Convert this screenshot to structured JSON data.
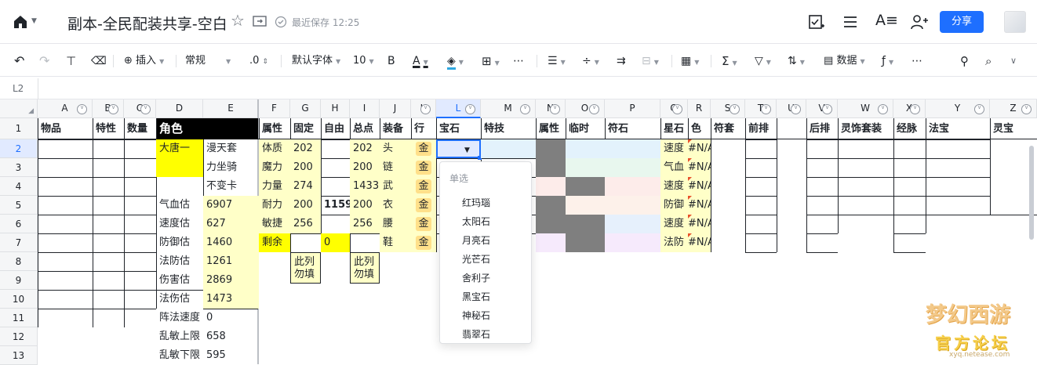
{
  "header": {
    "title": "副本-全民配装共享-空白",
    "saved": "最近保存 12:25",
    "share": "分享"
  },
  "toolbar": {
    "insert": "插入",
    "format": "常规",
    "decimal": ".0",
    "font": "默认字体",
    "size": "10",
    "data": "数据"
  },
  "namebox": "L2",
  "columns": [
    "A",
    "B",
    "C",
    "D",
    "E",
    "F",
    "G",
    "H",
    "I",
    "J",
    "K",
    "L",
    "M",
    "N",
    "O",
    "P",
    "Q",
    "R",
    "S",
    "T",
    "U",
    "V",
    "W",
    "X",
    "Y",
    "Z"
  ],
  "rows": [
    "1",
    "2",
    "3",
    "4",
    "5",
    "6",
    "7",
    "8",
    "9",
    "10",
    "11",
    "12",
    "13"
  ],
  "row1": {
    "A": "物品",
    "B": "特性",
    "C": "数量",
    "D": "角色",
    "F": "属性",
    "G": "固定",
    "H": "自由",
    "I": "总点",
    "J": "装备",
    "K": "行",
    "L": "宝石",
    "M": "特技",
    "N": "属性",
    "O": "临时",
    "P": "符石",
    "Q": "星石",
    "R": "色",
    "S": "符套",
    "T": "前排",
    "V": "后排",
    "W": "灵饰套装",
    "X": "经脉",
    "Y": "法宝",
    "Z": "灵宝"
  },
  "colD": {
    "r2": "大唐一",
    "r5": "气血估",
    "r6": "速度估",
    "r7": "防御估",
    "r8": "法防估",
    "r9": "伤害估",
    "r10": "法伤估",
    "r11": "阵法速度",
    "r12": "乱敏上限",
    "r13": "乱敏下限"
  },
  "colE": {
    "r2": "漫天套",
    "r3": "力坐骑",
    "r4": "不变卡",
    "r5": "6907",
    "r6": "627",
    "r7": "1460",
    "r8": "1261",
    "r9": "2869",
    "r10": "1473",
    "r11": "0",
    "r12": "658",
    "r13": "595"
  },
  "colF": [
    "体质",
    "魔力",
    "力量",
    "耐力",
    "敏捷",
    "剩余"
  ],
  "colG": [
    "202",
    "200",
    "274",
    "200",
    "256"
  ],
  "colH4": "1159",
  "colH7": "0",
  "colI": [
    "202",
    "200",
    "1433",
    "200",
    "256"
  ],
  "colJ": [
    "头",
    "链",
    "武",
    "衣",
    "腰",
    "鞋"
  ],
  "colK": [
    "金",
    "金",
    "金",
    "金",
    "金",
    "金"
  ],
  "colQ": [
    "速度",
    "气血",
    "速度",
    "防御",
    "速度",
    "法防"
  ],
  "colR": [
    "#N/A",
    "#N/A",
    "#N/A",
    "#N/A",
    "#N/A",
    "#N/A"
  ],
  "note": "此列\n勿填",
  "dropdown": {
    "header": "单选",
    "items": [
      "红玛瑙",
      "太阳石",
      "月亮石",
      "光芒石",
      "舍利子",
      "黑宝石",
      "神秘石",
      "翡翠石"
    ]
  },
  "watermark": {
    "title": "梦幻西游",
    "sub": "官方论坛",
    "url": "xyq.netease.com"
  }
}
